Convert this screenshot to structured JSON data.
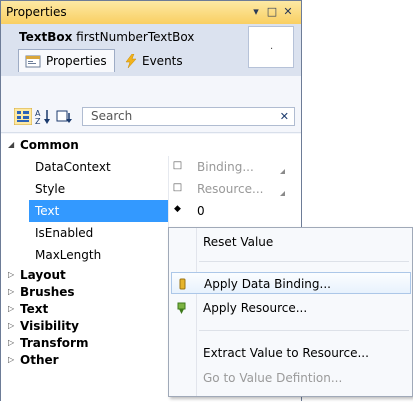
{
  "panel": {
    "title": "Properties",
    "title_buttons": [
      "▾",
      "□",
      "✕"
    ]
  },
  "header": {
    "type_name": "TextBox",
    "instance_name": "firstNumberTextBox",
    "preview_glyph": "·"
  },
  "tabs": [
    {
      "label": "Properties",
      "icon": "properties-icon",
      "active": true
    },
    {
      "label": "Events",
      "icon": "lightning-icon",
      "active": false
    }
  ],
  "toolbar": {
    "search_placeholder": "Search",
    "clear_glyph": "✕",
    "icons": [
      "categorize-icon",
      "sort-alpha-icon",
      "filter-icon"
    ]
  },
  "categories_top": {
    "label": "Common",
    "expanded": true
  },
  "properties": [
    {
      "name": "DataContext",
      "marker": "□",
      "value": "Binding..."
    },
    {
      "name": "Style",
      "marker": "□",
      "value": "Resource..."
    },
    {
      "name": "Text",
      "marker": "◆",
      "value": "0",
      "selected": true
    },
    {
      "name": "IsEnabled",
      "marker": "",
      "value": ""
    },
    {
      "name": "MaxLength",
      "marker": "",
      "value": ""
    }
  ],
  "categories": [
    {
      "label": "Layout"
    },
    {
      "label": "Brushes"
    },
    {
      "label": "Text"
    },
    {
      "label": "Visibility"
    },
    {
      "label": "Transform"
    },
    {
      "label": "Other"
    }
  ],
  "context_menu": {
    "items": [
      {
        "label": "Reset Value",
        "icon": "",
        "enabled": true
      },
      {
        "label": "Apply Data Binding...",
        "icon": "data-binding-icon",
        "enabled": true,
        "highlighted": true
      },
      {
        "label": "Apply Resource...",
        "icon": "resource-icon",
        "enabled": true
      },
      {
        "label": "Extract Value to Resource...",
        "icon": "",
        "enabled": true
      },
      {
        "label": "Go to Value Defintion...",
        "icon": "",
        "enabled": false
      }
    ]
  },
  "colors": {
    "titlebar": "#f9cf62",
    "header": "#dbe2ef",
    "selection": "#3399ff",
    "menu_highlight": "#e8f2fd"
  }
}
